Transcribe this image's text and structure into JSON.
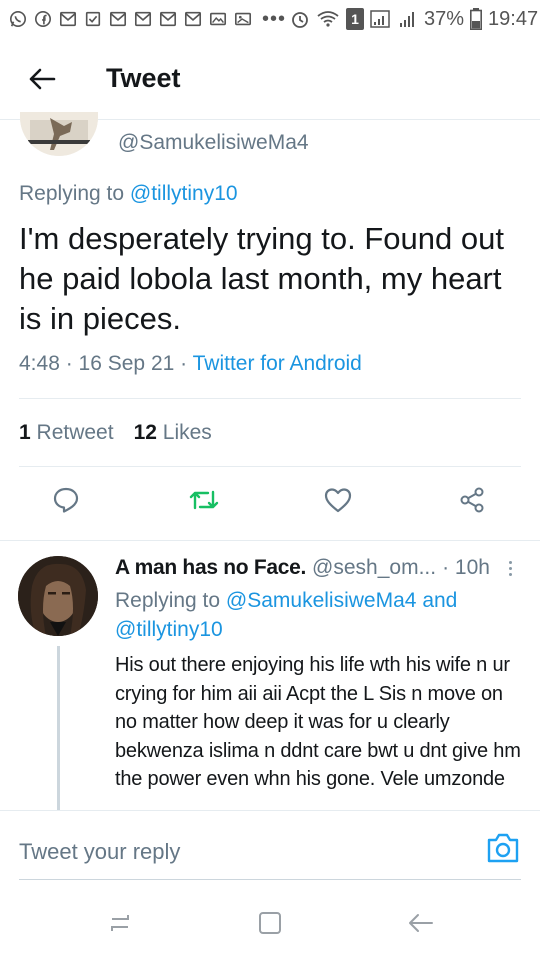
{
  "status_bar": {
    "battery": "37%",
    "time": "19:47",
    "sim_badge": "1"
  },
  "header": {
    "title": "Tweet"
  },
  "tweet": {
    "author_handle": "@SamukelisiweMa4",
    "replying_prefix": "Replying to",
    "replying_to": "@tillytiny10",
    "text": "I'm desperately trying to. Found out he paid lobola last month, my heart is in pieces.",
    "time": "4:48",
    "date": "16 Sep 21",
    "source": "Twitter for Android",
    "retweets_count": "1",
    "retweets_label": "Retweet",
    "likes_count": "12",
    "likes_label": "Likes"
  },
  "reply": {
    "name": "A man has no Face.",
    "handle": "@sesh_om...",
    "time": "· 10h",
    "replying_prefix": "Replying to",
    "replying_to_1": "@SamukelisiweMa4",
    "and_word": "and",
    "replying_to_2": "@tillytiny10",
    "text": "His out there enjoying his life wth his wife n ur crying for him aii aii Acpt the L Sis n move on no matter how deep it was for u clearly bekwenza islima n ddnt care bwt u dnt give hm the power even whn his gone. Vele umzonde"
  },
  "compose": {
    "placeholder": "Tweet your reply"
  },
  "colors": {
    "accent": "#1da1f2",
    "link": "#1b95e0",
    "retweet": "#17bf63",
    "muted": "#657786"
  }
}
